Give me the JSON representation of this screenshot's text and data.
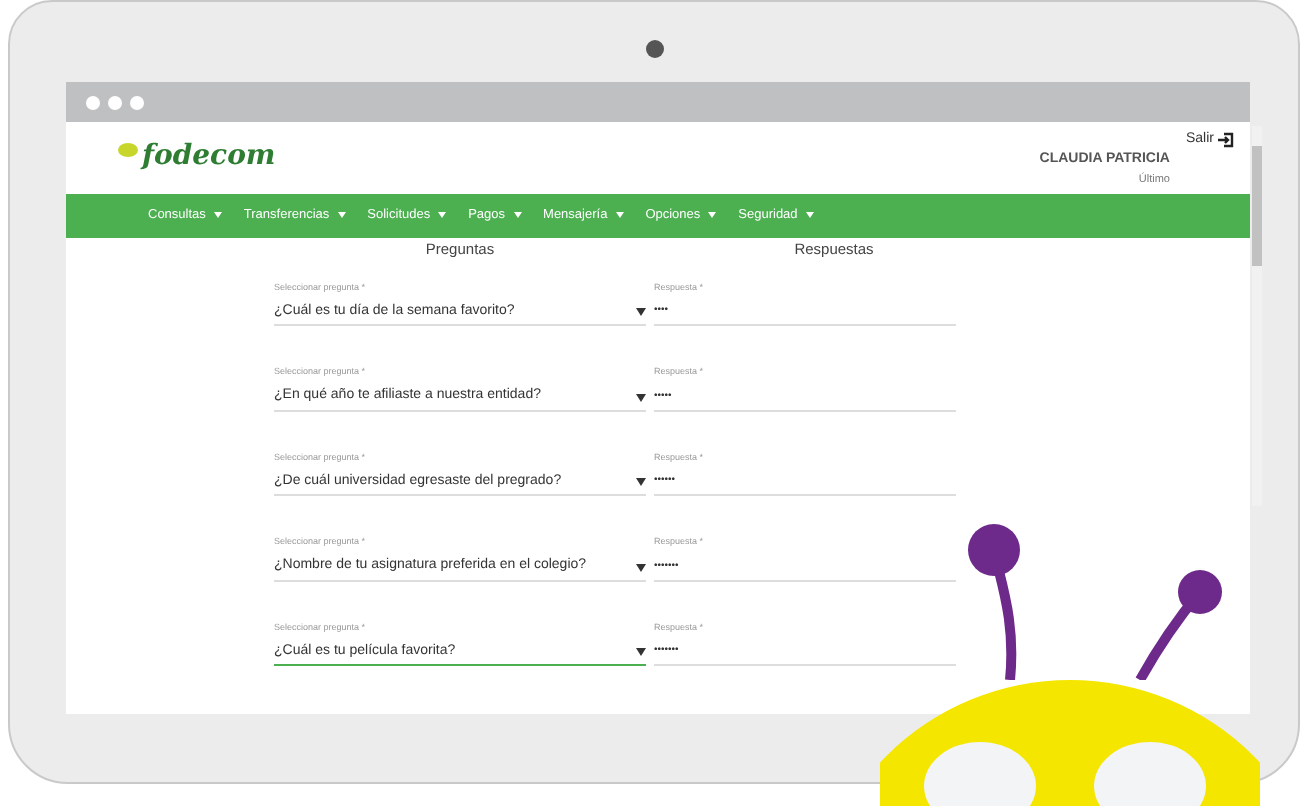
{
  "header": {
    "logo": "fodecom",
    "user_name": "CLAUDIA PATRICIA",
    "user_subtitle": "Último",
    "logout": "Salir"
  },
  "menu": [
    {
      "label": "Consultas"
    },
    {
      "label": "Transferencias"
    },
    {
      "label": "Solicitudes"
    },
    {
      "label": "Pagos"
    },
    {
      "label": "Mensajería"
    },
    {
      "label": "Opciones"
    },
    {
      "label": "Seguridad"
    }
  ],
  "columns": [
    "Preguntas",
    "Respuestas"
  ],
  "rows": [
    {
      "question_label": "Seleccionar pregunta *",
      "question": "¿Cuál es tu día de la semana favorito?",
      "answer_label": "Respuesta *",
      "answer": "••••",
      "focused": false
    },
    {
      "question_label": "Seleccionar pregunta *",
      "question": "¿En qué año te afiliaste a nuestra entidad?",
      "answer_label": "Respuesta *",
      "answer": "•••••",
      "focused": false
    },
    {
      "question_label": "Seleccionar pregunta *",
      "question": "¿De cuál universidad egresaste del pregrado?",
      "answer_label": "Respuesta *",
      "answer": "••••••",
      "focused": false
    },
    {
      "question_label": "Seleccionar pregunta *",
      "question": "¿Nombre de tu asignatura preferida en el colegio?",
      "answer_label": "Respuesta *",
      "answer": "•••••••",
      "focused": false
    },
    {
      "question_label": "Seleccionar pregunta *",
      "question": "¿Cuál es tu película favorita?",
      "answer_label": "Respuesta *",
      "answer": "•••••••",
      "focused": true
    }
  ]
}
